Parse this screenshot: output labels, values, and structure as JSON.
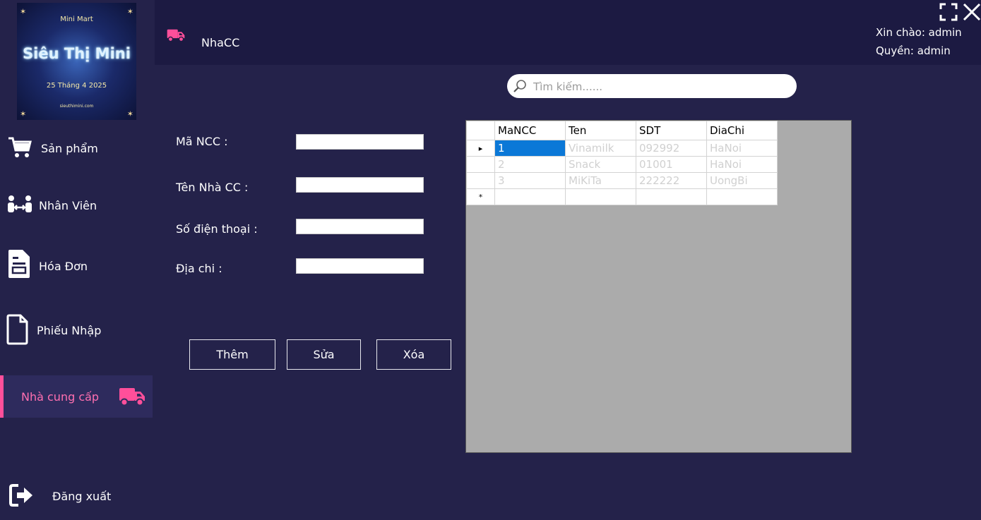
{
  "logo": {
    "top_text": "Mini Mart",
    "main_text": "Siêu Thị Mini",
    "date_text": "25 Tháng 4 2025",
    "site_text": "sieuthimini.com"
  },
  "sidebar": {
    "items": [
      {
        "label": "Sản phẩm",
        "icon": "cart-icon"
      },
      {
        "label": "Nhân Viên",
        "icon": "people-transfer-icon"
      },
      {
        "label": "Hóa Đơn",
        "icon": "invoice-icon"
      },
      {
        "label": "Phiếu Nhập",
        "icon": "document-icon"
      },
      {
        "label": "Nhà cung cấp",
        "icon": "truck-icon",
        "active": true
      },
      {
        "label": "Đăng xuất",
        "icon": "logout-icon"
      }
    ]
  },
  "header": {
    "title": "NhaCC",
    "greeting": "Xin chào: admin",
    "role": "Quyền: admin",
    "accent": "#ff4f9a"
  },
  "search": {
    "placeholder": "Tìm kiếm......"
  },
  "form": {
    "labels": {
      "ma_ncc": "Mã NCC :",
      "ten_nha_cc": "Tên Nhà CC :",
      "so_dien_thoai": "Số điện thoại :",
      "dia_chi": "Địa chi :"
    },
    "values": {
      "ma_ncc": "",
      "ten_nha_cc": "",
      "so_dien_thoai": "",
      "dia_chi": ""
    }
  },
  "buttons": {
    "add": "Thêm",
    "edit": "Sửa",
    "delete": "Xóa"
  },
  "table": {
    "columns": [
      "MaNCC",
      "Ten",
      "SDT",
      "DiaChi"
    ],
    "rows": [
      [
        "1",
        "Vinamilk",
        "092992",
        "HaNoi"
      ],
      [
        "2",
        "Snack",
        "01001",
        "HaNoi"
      ],
      [
        "3",
        "MiKiTa",
        "222222",
        "UongBi"
      ]
    ],
    "current_row_marker": "▸",
    "new_row_marker": "*"
  },
  "colors": {
    "background": "#24224a",
    "header_bg": "#1c1a42",
    "active_item_bg": "#2e2b5d",
    "accent_pink": "#ff4f9a",
    "selected_cell": "#0b78d7",
    "grid_bg": "#ababab"
  }
}
